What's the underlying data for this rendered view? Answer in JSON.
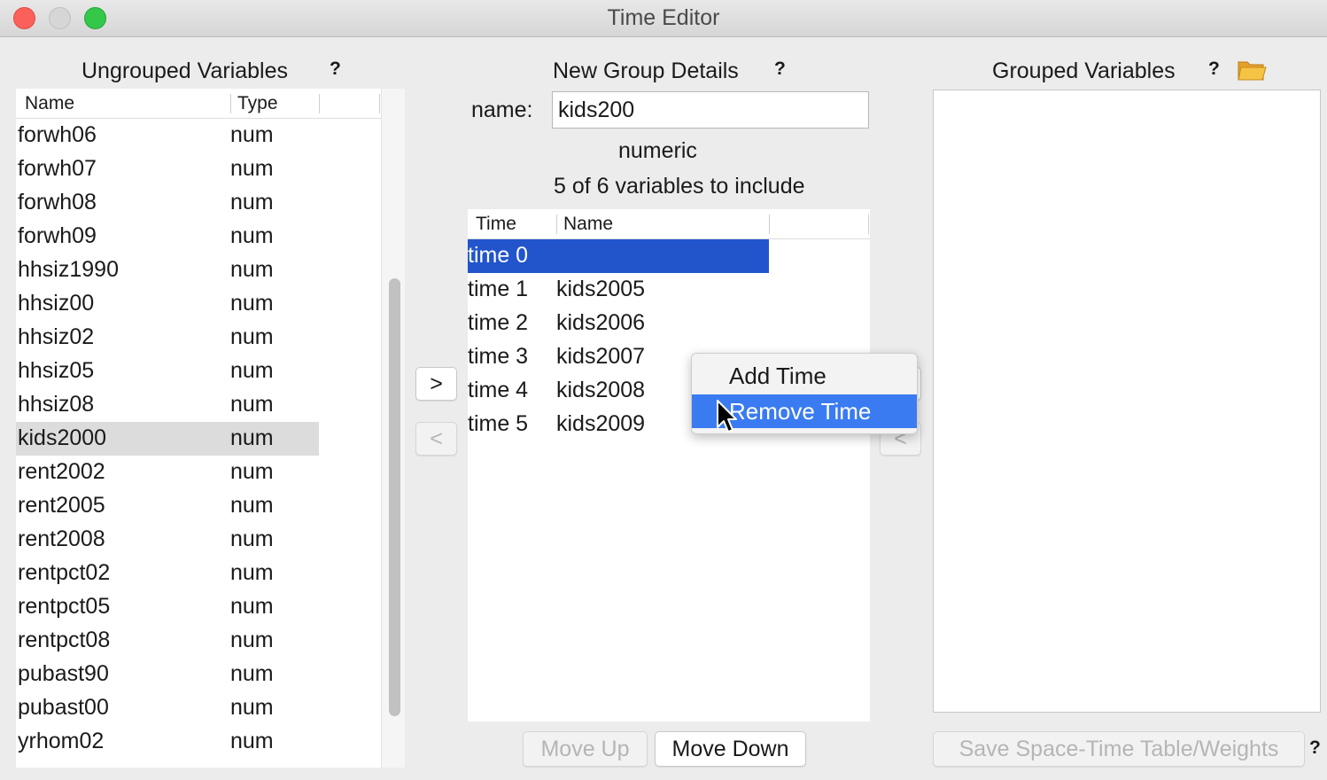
{
  "window": {
    "title": "Time Editor"
  },
  "ungrouped": {
    "title": "Ungrouped Variables",
    "help": "?",
    "columns": [
      "Name",
      "Type"
    ],
    "rows": [
      {
        "name": "forwh06",
        "type": "num"
      },
      {
        "name": "forwh07",
        "type": "num"
      },
      {
        "name": "forwh08",
        "type": "num"
      },
      {
        "name": "forwh09",
        "type": "num"
      },
      {
        "name": "hhsiz1990",
        "type": "num"
      },
      {
        "name": "hhsiz00",
        "type": "num"
      },
      {
        "name": "hhsiz02",
        "type": "num"
      },
      {
        "name": "hhsiz05",
        "type": "num"
      },
      {
        "name": "hhsiz08",
        "type": "num"
      },
      {
        "name": "kids2000",
        "type": "num",
        "selected": true
      },
      {
        "name": "rent2002",
        "type": "num"
      },
      {
        "name": "rent2005",
        "type": "num"
      },
      {
        "name": "rent2008",
        "type": "num"
      },
      {
        "name": "rentpct02",
        "type": "num"
      },
      {
        "name": "rentpct05",
        "type": "num"
      },
      {
        "name": "rentpct08",
        "type": "num"
      },
      {
        "name": "pubast90",
        "type": "num"
      },
      {
        "name": "pubast00",
        "type": "num"
      },
      {
        "name": "yrhom02",
        "type": "num"
      }
    ]
  },
  "move_buttons": {
    "add": ">",
    "remove": "<"
  },
  "new_group": {
    "title": "New Group Details",
    "help": "?",
    "name_label": "name:",
    "name_value": "kids200",
    "type_text": "numeric",
    "count_text": "5 of 6 variables to include",
    "columns": [
      "Time",
      "Name"
    ],
    "rows": [
      {
        "time": "time 0",
        "name": "",
        "selected": true
      },
      {
        "time": "time 1",
        "name": "kids2005"
      },
      {
        "time": "time 2",
        "name": "kids2006"
      },
      {
        "time": "time 3",
        "name": "kids2007"
      },
      {
        "time": "time 4",
        "name": "kids2008"
      },
      {
        "time": "time 5",
        "name": "kids2009"
      }
    ],
    "move_up": "Move Up",
    "move_down": "Move Down"
  },
  "grouped": {
    "title": "Grouped Variables",
    "help": "?",
    "folder_icon": "folder-open-icon",
    "save_button": "Save Space-Time Table/Weights",
    "save_help": "?"
  },
  "context_menu": {
    "items": [
      {
        "label": "Add Time",
        "highlighted": false
      },
      {
        "label": "Remove Time",
        "highlighted": true
      }
    ]
  },
  "colors": {
    "selection_blue": "#2255cc",
    "menu_highlight": "#3a7bf2",
    "row_selected_gray": "#dcdcdc"
  }
}
